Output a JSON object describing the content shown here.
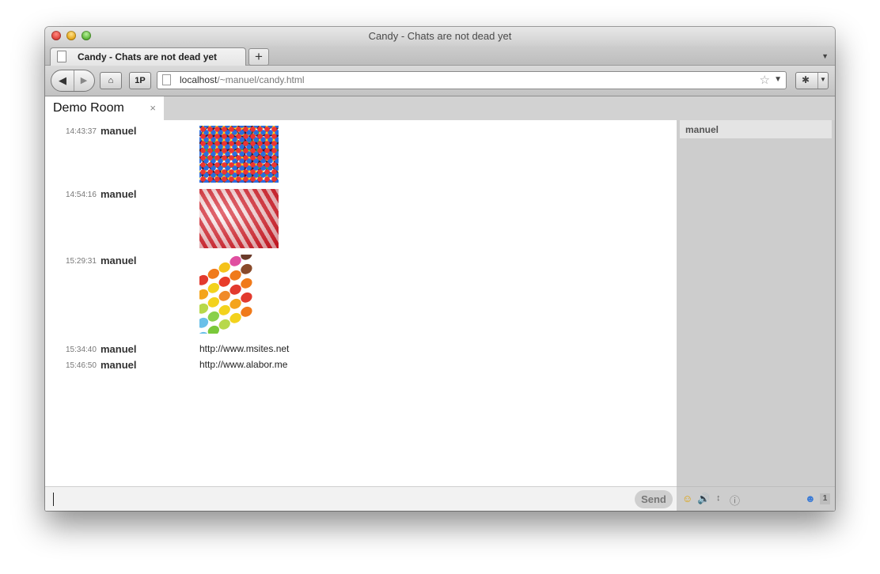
{
  "window": {
    "title": "Candy - Chats are not dead yet"
  },
  "browser": {
    "tab_label": "Candy - Chats are not dead yet",
    "new_tab_label": "+",
    "onepassword_label": "1P",
    "url_host": "localhost",
    "url_path": "/~manuel/candy.html"
  },
  "room": {
    "name": "Demo Room",
    "close_label": "×"
  },
  "messages": [
    {
      "time": "14:43:37",
      "user": "manuel",
      "image": "sprinkles"
    },
    {
      "time": "14:54:16",
      "user": "manuel",
      "image": "candy-canes"
    },
    {
      "time": "15:29:31",
      "user": "manuel",
      "image": "colorful-candies"
    },
    {
      "time": "15:34:40",
      "user": "manuel",
      "text": "http://www.msites.net"
    },
    {
      "time": "15:46:50",
      "user": "manuel",
      "text": "http://www.alabor.me"
    }
  ],
  "roster": {
    "users": [
      "manuel"
    ]
  },
  "form": {
    "send_label": "Send",
    "user_count": "1"
  },
  "icons": [
    "page-icon",
    "back-arrow-icon",
    "forward-arrow-icon",
    "home-icon",
    "star-icon",
    "emoticon-icon",
    "sound-icon",
    "autoscroll-icon",
    "status-icon",
    "users-icon"
  ]
}
